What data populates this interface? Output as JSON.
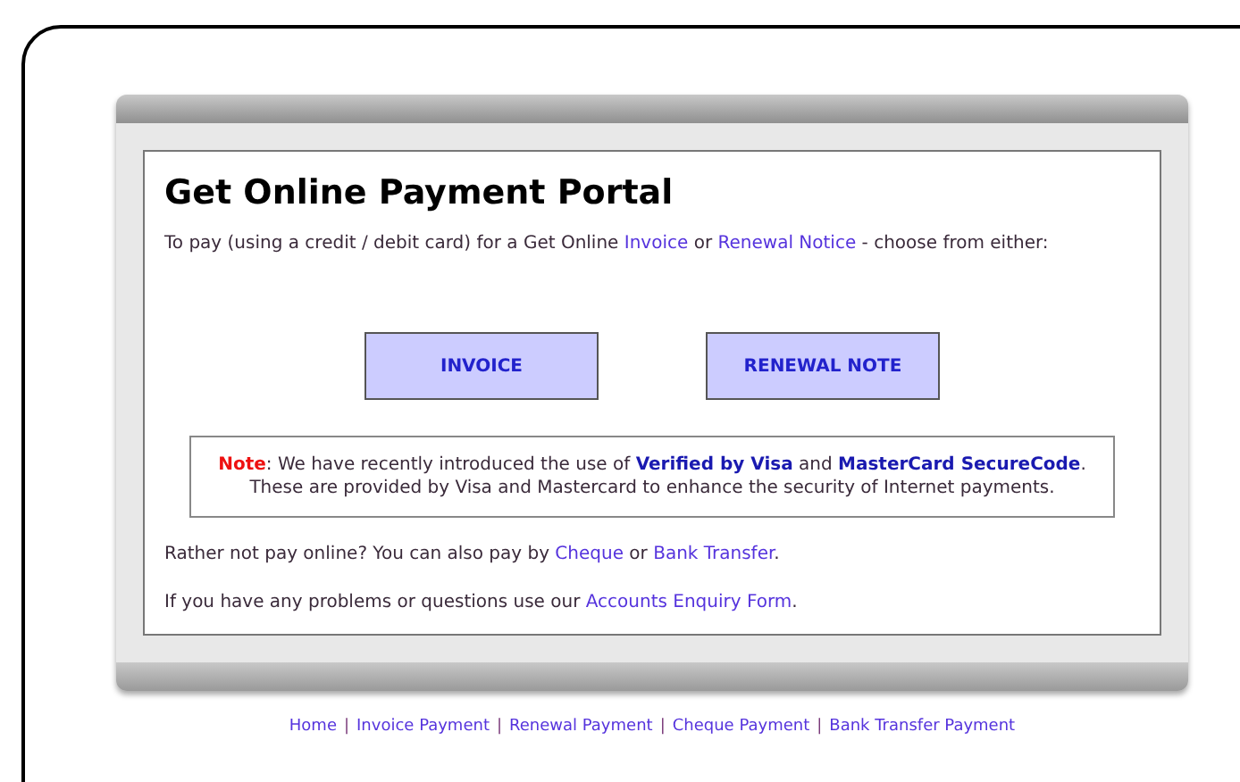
{
  "title": "Get Online Payment Portal",
  "intro": [
    {
      "kind": "text",
      "text": "To pay (using a credit / debit card) for a Get Online "
    },
    {
      "kind": "link",
      "text": "Invoice"
    },
    {
      "kind": "text",
      "text": " or "
    },
    {
      "kind": "link",
      "text": "Renewal Notice"
    },
    {
      "kind": "text",
      "text": " - choose from either:"
    }
  ],
  "buttons": [
    "INVOICE",
    "RENEWAL NOTE"
  ],
  "note": [
    {
      "kind": "label",
      "text": "Note"
    },
    {
      "kind": "text",
      "text": ": We have recently introduced the use of "
    },
    {
      "kind": "strong-link",
      "text": "Verified by Visa"
    },
    {
      "kind": "text",
      "text": " and "
    },
    {
      "kind": "strong-link",
      "text": "MasterCard SecureCode"
    },
    {
      "kind": "text",
      "text": ". These are provided by Visa and Mastercard to enhance the security of Internet payments."
    }
  ],
  "paragraphs": [
    [
      {
        "kind": "text",
        "text": "Rather not pay online? You can also pay by "
      },
      {
        "kind": "link",
        "text": "Cheque"
      },
      {
        "kind": "text",
        "text": " or "
      },
      {
        "kind": "link",
        "text": "Bank Transfer"
      },
      {
        "kind": "text",
        "text": "."
      }
    ],
    [
      {
        "kind": "text",
        "text": "If you have any problems or questions use our "
      },
      {
        "kind": "link",
        "text": "Accounts Enquiry Form"
      },
      {
        "kind": "text",
        "text": "."
      }
    ]
  ],
  "footer_links": [
    "Home",
    "Invoice Payment",
    "Renewal Payment",
    "Cheque Payment",
    "Bank Transfer Payment"
  ],
  "footer_separator": "|"
}
